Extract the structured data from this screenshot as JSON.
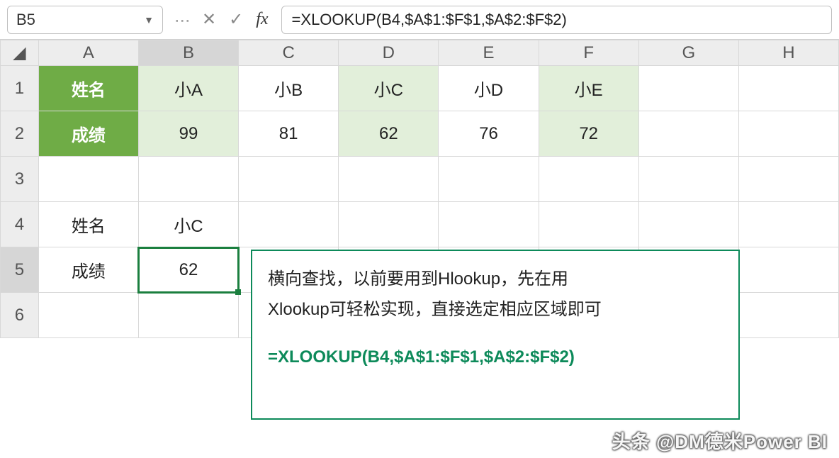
{
  "namebox": "B5",
  "formula": "=XLOOKUP(B4,$A$1:$F$1,$A$2:$F$2)",
  "columns": [
    "A",
    "B",
    "C",
    "D",
    "E",
    "F",
    "G",
    "H"
  ],
  "rows": [
    "1",
    "2",
    "3",
    "4",
    "5",
    "6"
  ],
  "cells": {
    "A1": "姓名",
    "B1": "小A",
    "C1": "小B",
    "D1": "小C",
    "E1": "小D",
    "F1": "小E",
    "A2": "成绩",
    "B2": "99",
    "C2": "81",
    "D2": "62",
    "E2": "76",
    "F2": "72",
    "A4": "姓名",
    "B4": "小C",
    "A5": "成绩",
    "B5": "62"
  },
  "callout": {
    "line1": "横向查找，以前要用到Hlookup，先在用",
    "line2": "Xlookup可轻松实现，直接选定相应区域即可",
    "formula": "=XLOOKUP(B4,$A$1:$F$1,$A$2:$F$2)"
  },
  "watermark": "头条 @DM德米Power BI",
  "chart_data": {
    "type": "table",
    "title": "成绩 (Scores)",
    "categories": [
      "小A",
      "小B",
      "小C",
      "小D",
      "小E"
    ],
    "values": [
      99,
      81,
      62,
      76,
      72
    ],
    "lookup_example": {
      "name": "小C",
      "score": 62
    }
  }
}
